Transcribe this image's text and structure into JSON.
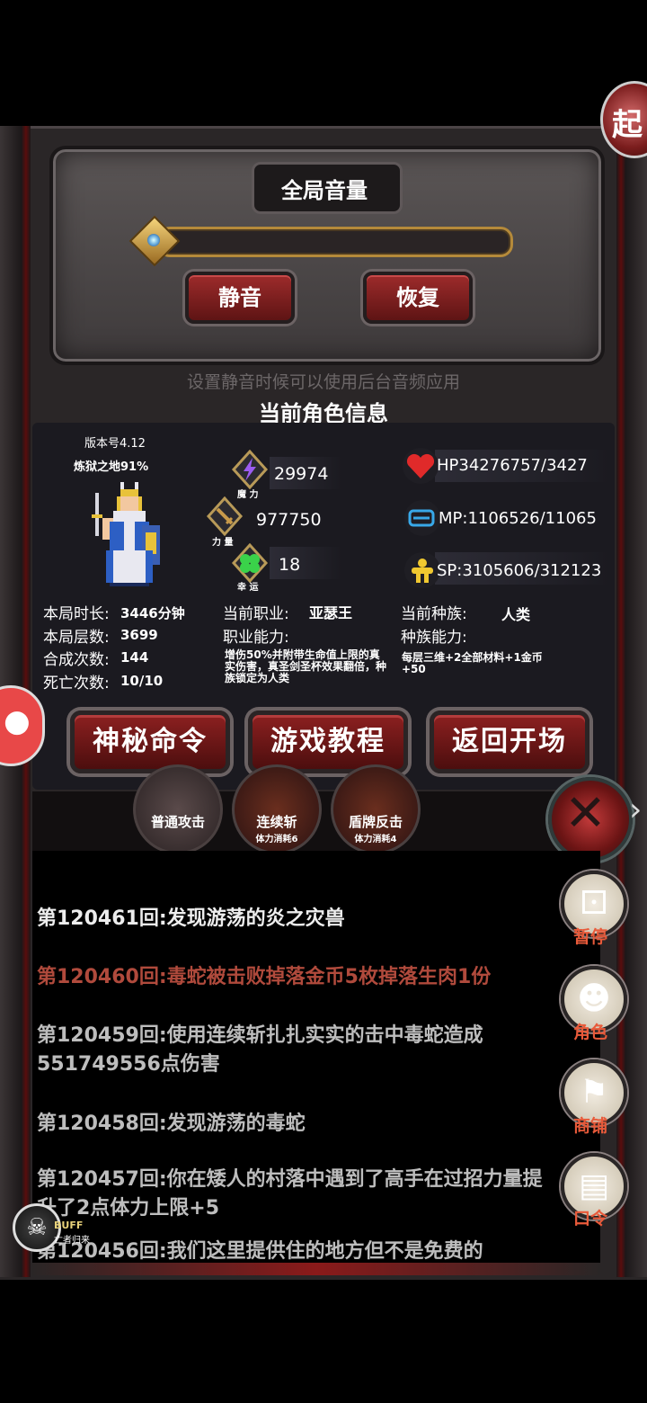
{
  "top_emblem": {
    "glyph": "起"
  },
  "volume": {
    "title": "全局音量",
    "mute_label": "静音",
    "restore_label": "恢复",
    "hint": "设置静音时候可以使用后台音频应用"
  },
  "character": {
    "title": "当前角色信息",
    "version": "版本号4.12",
    "hell_progress": "炼狱之地91%",
    "stats": {
      "magic": {
        "label": "魔 力",
        "value": "29974"
      },
      "power": {
        "label": "力 量",
        "value": "977750"
      },
      "luck": {
        "label": "幸 运",
        "value": "18"
      }
    },
    "hp": "HP34276757/3427",
    "mp": "MP:1106526/11065",
    "sp": "SP:3105606/312123",
    "info": {
      "time_label": "本局时长:",
      "time_value": "3446分钟",
      "floors_label": "本局层数:",
      "floors_value": "3699",
      "craft_label": "合成次数:",
      "craft_value": "144",
      "death_label": "死亡次数:",
      "death_value": "10/10",
      "job_label": "当前职业:",
      "job_value": "亚瑟王",
      "job_ability_label": "职业能力:",
      "job_ability_desc": "增伤50%并附带生命值上限的真实伤害，真圣剑圣杯效果翻倍，种族锁定为人类",
      "race_label": "当前种族:",
      "race_value": "人类",
      "race_ability_label": "种族能力:",
      "race_ability_desc": "每层三维+2全部材料+1金币+50"
    }
  },
  "buttons": {
    "secret": "神秘命令",
    "tutorial": "游戏教程",
    "return": "返回开场"
  },
  "skills": [
    {
      "name": "普通攻击",
      "cost": ""
    },
    {
      "name": "连续斩",
      "cost": "体力消耗6"
    },
    {
      "name": "盾牌反击",
      "cost": "体力消耗4"
    }
  ],
  "log": [
    "第120461回:发现游荡的炎之灾兽",
    "第120460回:毒蛇被击败掉落金币5枚掉落生肉1份",
    "第120459回:使用连续斩扎扎实实的击中毒蛇造成551749556点伤害",
    "第120458回:发现游荡的毒蛇",
    "第120457回:你在矮人的村落中遇到了高手在过招力量提升了2点体力上限+5",
    "第120456回:我们这里提供住的地方但不是免费的"
  ],
  "menu": {
    "pause": "暂停",
    "role": "角色",
    "shop": "商铺",
    "command": "口令"
  },
  "buff": {
    "label": "BUFF",
    "name": "亡者归来"
  },
  "colors": {
    "accent_red": "#8c2020",
    "log_highlight": "#b04a3c",
    "menu_label": "#e85a3a"
  }
}
